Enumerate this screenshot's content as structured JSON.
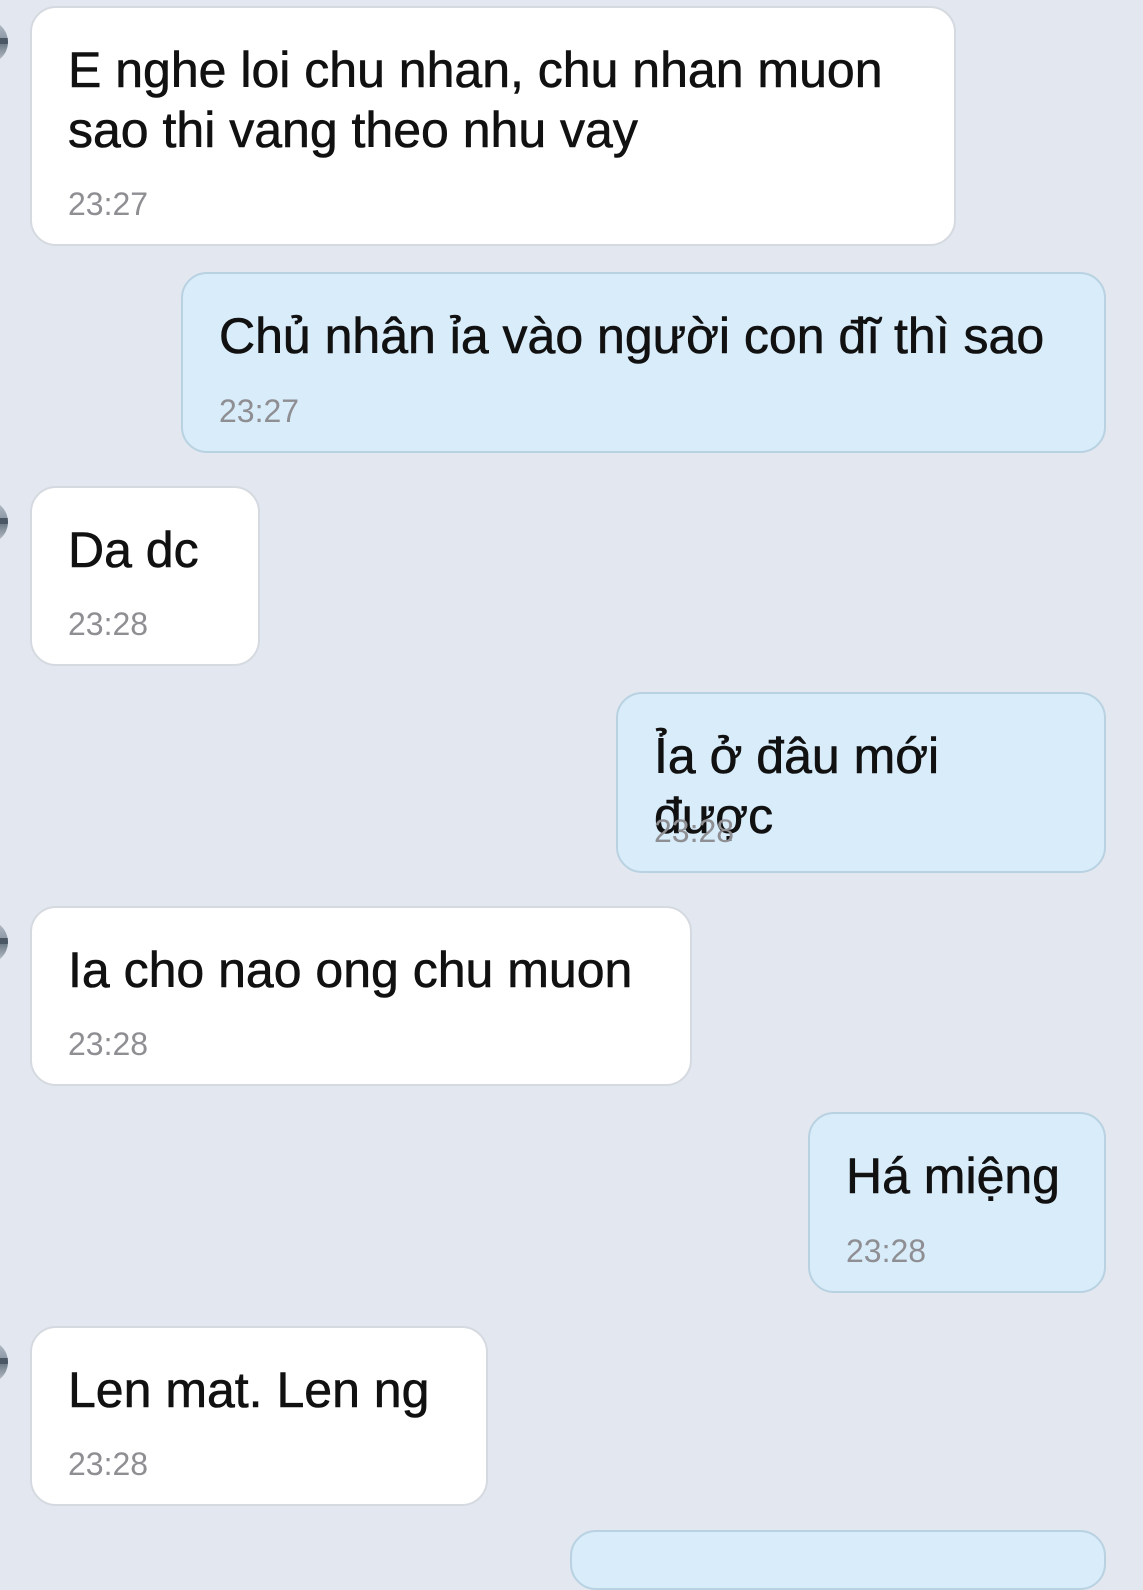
{
  "messages": [
    {
      "direction": "incoming",
      "text": "E nghe loi chu nhan, chu nhan muon\nsao thi vang theo nhu vay",
      "time": "23:27"
    },
    {
      "direction": "outgoing",
      "text": "Chủ nhân ỉa vào người con đĩ thì sao",
      "time": "23:27"
    },
    {
      "direction": "incoming",
      "text": "Da dc",
      "time": "23:28"
    },
    {
      "direction": "outgoing",
      "text": "Ỉa ở đâu mới được",
      "time": "23:28"
    },
    {
      "direction": "incoming",
      "text": "Ia cho nao ong chu muon",
      "time": "23:28"
    },
    {
      "direction": "outgoing",
      "text": "Há miệng",
      "time": "23:28"
    },
    {
      "direction": "incoming",
      "text": "Len mat. Len ng",
      "time": "23:28"
    }
  ],
  "colors": {
    "background": "#e3e7ef",
    "incoming_bubble": "#ffffff",
    "outgoing_bubble": "#d8ecfa",
    "timestamp": "#8e8e93"
  }
}
